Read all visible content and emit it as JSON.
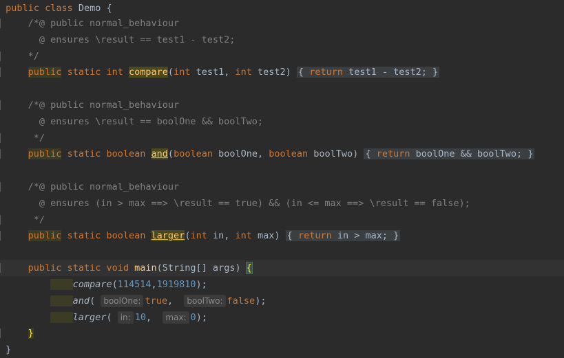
{
  "code": {
    "class_decl": {
      "kw1": "public",
      "kw2": "class",
      "name": "Demo",
      "brace": "{"
    },
    "spec1": {
      "open": "/*@ public normal_behaviour",
      "ensures": "@ ensures \\result == test1 - test2;",
      "close": "*/"
    },
    "method1": {
      "public": "public",
      "static": "static",
      "type": "int",
      "name": "compare",
      "params_open": "(",
      "p1_type": "int",
      "p1_name": " test1, ",
      "p2_type": "int",
      "p2_name": " test2)",
      "body_open": "{",
      "return_kw": "return",
      "body_expr": " test1 - test2;",
      "body_close": "}"
    },
    "spec2": {
      "open": "/*@ public normal_behaviour",
      "ensures": "@ ensures \\result == boolOne && boolTwo;",
      "close": "*/"
    },
    "method2": {
      "public": "public",
      "static": "static",
      "type": "boolean",
      "name": "and",
      "params_open": "(",
      "p1_type": "boolean",
      "p1_name": " boolOne, ",
      "p2_type": "boolean",
      "p2_name": " boolTwo)",
      "body_open": "{",
      "return_kw": "return",
      "body_expr": " boolOne && boolTwo;",
      "body_close": "}"
    },
    "spec3": {
      "open": "/*@ public normal_behaviour",
      "ensures": "@ ensures (in > max ==> \\result == true) && (in <= max ==> \\result == false);",
      "close": "*/"
    },
    "method3": {
      "public": "public",
      "static": "static",
      "type": "boolean",
      "name": "larger",
      "params_open": "(",
      "p1_type": "int",
      "p1_name": " in, ",
      "p2_type": "int",
      "p2_name": " max)",
      "body_open": "{",
      "return_kw": "return",
      "body_expr": " in > max;",
      "body_close": "}"
    },
    "main": {
      "public": "public",
      "static": "static",
      "type": "void",
      "name": "main",
      "sig": "(String[] args) ",
      "brace": "{",
      "close": "}"
    },
    "call1": {
      "name": "compare",
      "open": "(",
      "arg1": "114514",
      "comma": ",",
      "arg2": "1919810",
      "close": ");"
    },
    "call2": {
      "name": "and",
      "open": "( ",
      "hint1": "boolOne:",
      "arg1": "true",
      "sep": ",  ",
      "hint2": "boolTwo:",
      "arg2": "false",
      "close": ");"
    },
    "call3": {
      "name": "larger",
      "open": "( ",
      "hint1": "in:",
      "arg1": "10",
      "sep": ",  ",
      "hint2": "max:",
      "arg2": "0",
      "close": ");"
    },
    "class_close": "}"
  }
}
